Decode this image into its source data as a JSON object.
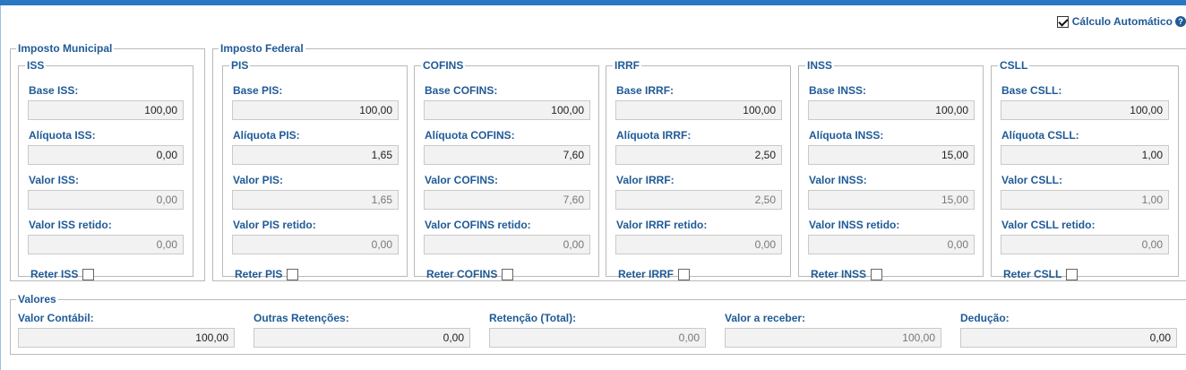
{
  "auto_calc": {
    "label": "Cálculo Automático",
    "checked": true
  },
  "municipal": {
    "legend": "Imposto Municipal",
    "iss": {
      "legend": "ISS",
      "base_label": "Base ISS:",
      "base_value": "100,00",
      "aliquota_label": "Alíquota ISS:",
      "aliquota_value": "0,00",
      "valor_label": "Valor ISS:",
      "valor_value": "0,00",
      "retido_label": "Valor ISS retido:",
      "retido_value": "0,00",
      "reter_label": "Reter ISS"
    }
  },
  "federal": {
    "legend": "Imposto Federal",
    "pis": {
      "legend": "PIS",
      "base_label": "Base PIS:",
      "base_value": "100,00",
      "aliquota_label": "Alíquota PIS:",
      "aliquota_value": "1,65",
      "valor_label": "Valor PIS:",
      "valor_value": "1,65",
      "retido_label": "Valor PIS retido:",
      "retido_value": "0,00",
      "reter_label": "Reter PIS"
    },
    "cofins": {
      "legend": "COFINS",
      "base_label": "Base COFINS:",
      "base_value": "100,00",
      "aliquota_label": "Alíquota COFINS:",
      "aliquota_value": "7,60",
      "valor_label": "Valor COFINS:",
      "valor_value": "7,60",
      "retido_label": "Valor COFINS retido:",
      "retido_value": "0,00",
      "reter_label": "Reter COFINS"
    },
    "irrf": {
      "legend": "IRRF",
      "base_label": "Base IRRF:",
      "base_value": "100,00",
      "aliquota_label": "Alíquota IRRF:",
      "aliquota_value": "2,50",
      "valor_label": "Valor IRRF:",
      "valor_value": "2,50",
      "retido_label": "Valor IRRF retido:",
      "retido_value": "0,00",
      "reter_label": "Reter IRRF"
    },
    "inss": {
      "legend": "INSS",
      "base_label": "Base INSS:",
      "base_value": "100,00",
      "aliquota_label": "Alíquota INSS:",
      "aliquota_value": "15,00",
      "valor_label": "Valor INSS:",
      "valor_value": "15,00",
      "retido_label": "Valor INSS retido:",
      "retido_value": "0,00",
      "reter_label": "Reter INSS"
    },
    "csll": {
      "legend": "CSLL",
      "base_label": "Base CSLL:",
      "base_value": "100,00",
      "aliquota_label": "Alíquota CSLL:",
      "aliquota_value": "1,00",
      "valor_label": "Valor CSLL:",
      "valor_value": "1,00",
      "retido_label": "Valor CSLL retido:",
      "retido_value": "0,00",
      "reter_label": "Reter CSLL"
    }
  },
  "valores": {
    "legend": "Valores",
    "contabil_label": "Valor Contábil:",
    "contabil_value": "100,00",
    "outras_label": "Outras Retenções:",
    "outras_value": "0,00",
    "retencao_label": "Retenção (Total):",
    "retencao_value": "0,00",
    "receber_label": "Valor a receber:",
    "receber_value": "100,00",
    "deducao_label": "Dedução:",
    "deducao_value": "0,00"
  }
}
